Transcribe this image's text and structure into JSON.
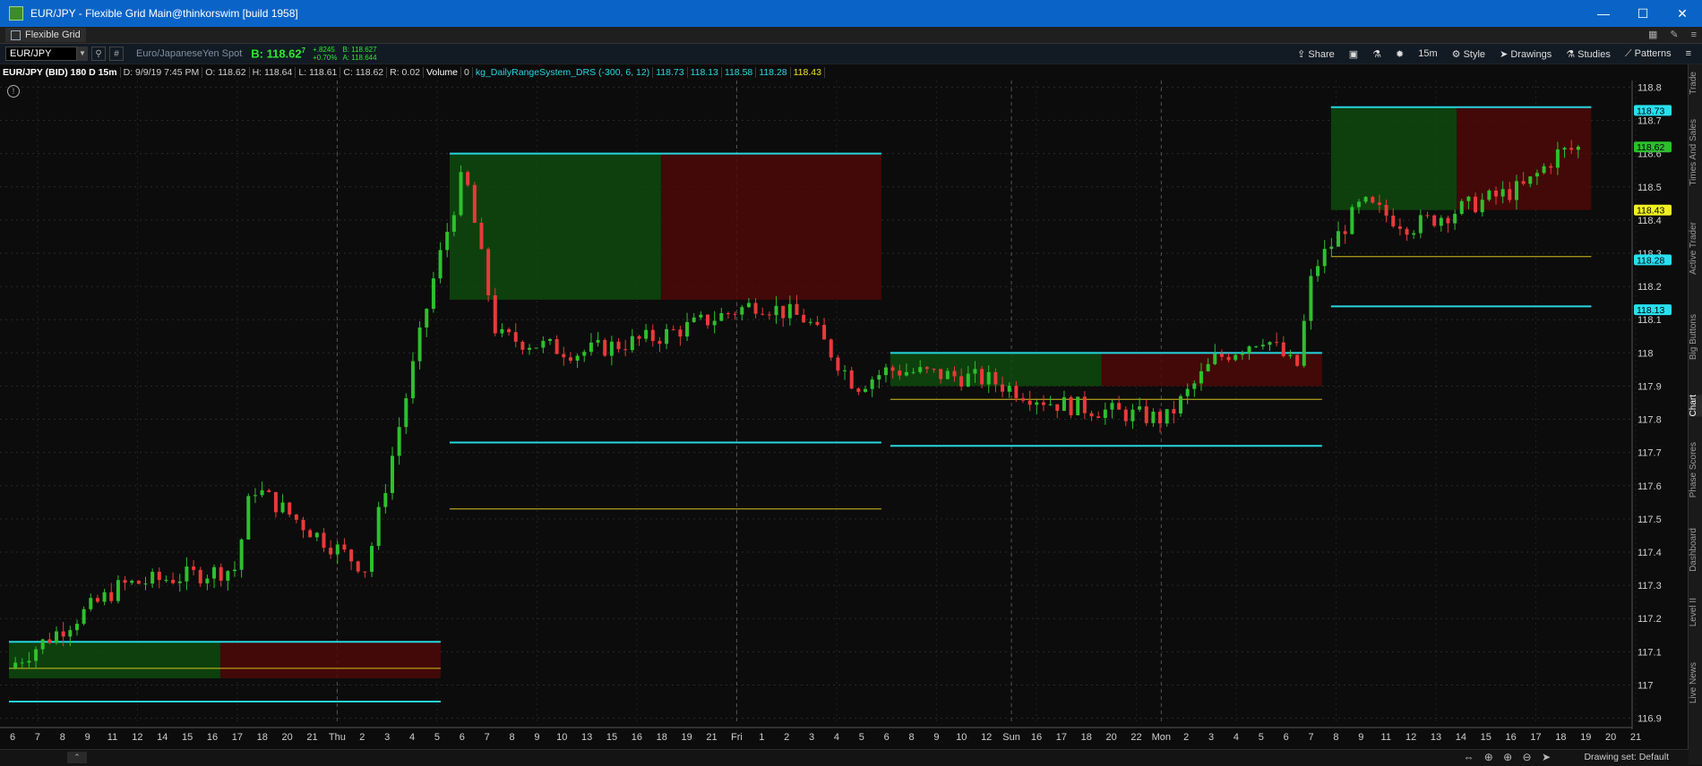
{
  "window": {
    "title": "EUR/JPY - Flexible Grid Main@thinkorswim [build 1958]",
    "min": "—",
    "max": "☐",
    "close": "✕"
  },
  "tabbar": {
    "tab": "Flexible Grid"
  },
  "toolbar": {
    "symbol": "EUR/JPY",
    "description": "Euro/JapaneseYen Spot",
    "bid": "B: 118.62",
    "bid_frac": "7",
    "change_net": "+.8245",
    "change_pct": "+0.70%",
    "bid_small": "B: 118.627",
    "ask_small": "A: 118.644",
    "share": "Share",
    "interval": "15m",
    "style": "Style",
    "drawings": "Drawings",
    "studies": "Studies",
    "patterns": "Patterns"
  },
  "infobar": {
    "title": "EUR/JPY (BID) 180 D 15m",
    "date": "D: 9/9/19 7:45 PM",
    "open": "O: 118.62",
    "high": "H: 118.64",
    "low": "L: 118.61",
    "close": "C: 118.62",
    "range": "R: 0.02",
    "volume_label": "Volume",
    "volume_value": "0",
    "study": "kg_DailyRangeSystem_DRS (-300, 6, 12)",
    "v1": "118.73",
    "v2": "118.13",
    "v3": "118.58",
    "v4": "118.28",
    "v5": "118.43"
  },
  "chart_data": {
    "type": "candlestick",
    "y_axis": {
      "min": 116.88,
      "max": 118.82,
      "ticks": [
        "118.8",
        "118.7",
        "118.6",
        "118.5",
        "118.4",
        "118.3",
        "118.2",
        "118.1",
        "118",
        "117.9",
        "117.8",
        "117.7",
        "117.6",
        "117.5",
        "117.4",
        "117.3",
        "117.2",
        "117.1",
        "117",
        "116.9"
      ]
    },
    "x_ticks": [
      "6",
      "7",
      "8",
      "9",
      "11",
      "12",
      "14",
      "15",
      "16",
      "17",
      "18",
      "20",
      "21",
      "Thu",
      "2",
      "3",
      "4",
      "5",
      "6",
      "7",
      "8",
      "9",
      "10",
      "13",
      "15",
      "16",
      "18",
      "19",
      "21",
      "Fri",
      "1",
      "2",
      "3",
      "4",
      "5",
      "6",
      "8",
      "9",
      "10",
      "12",
      "Sun",
      "16",
      "17",
      "18",
      "20",
      "22",
      "Mon",
      "2",
      "3",
      "4",
      "5",
      "6",
      "7",
      "8",
      "9",
      "11",
      "12",
      "13",
      "14",
      "15",
      "16",
      "17",
      "18",
      "19",
      "20",
      "21"
    ],
    "price_labels": [
      {
        "value": 118.73,
        "text": "118.73",
        "color": "#26e0f0"
      },
      {
        "value": 118.62,
        "text": "118.62",
        "color": "#2cc02c"
      },
      {
        "value": 118.43,
        "text": "118.43",
        "color": "#f0f020"
      },
      {
        "value": 118.28,
        "text": "118.28",
        "color": "#26e0f0"
      },
      {
        "value": 118.13,
        "text": "118.13",
        "color": "#26e0f0"
      }
    ],
    "day_zones": [
      {
        "upper": 117.13,
        "lower": 116.95,
        "mid": 117.02,
        "close_line": 117.05
      },
      {
        "upper": 118.6,
        "lower": 117.73,
        "mid": 118.16,
        "close_line": 117.53
      },
      {
        "upper": 118.0,
        "lower": 117.72,
        "mid": 117.9,
        "close_line": 117.86
      },
      {
        "upper": 118.74,
        "lower": 118.14,
        "mid": 118.43,
        "close_line": 118.29
      }
    ],
    "colors": {
      "up": "#2ec02e",
      "down": "#e83a3a",
      "band_line": "#26d6e0",
      "mid_line": "#d8c020",
      "green_fill": "#0e4a0e",
      "red_fill": "#4e0808"
    },
    "last_price": 118.627
  },
  "sidetabs": [
    "Trade",
    "Times And Sales",
    "Active Trader",
    "Big Buttons",
    "Chart",
    "Phase Scores",
    "Dashboard",
    "Level II",
    "Live News"
  ],
  "statusbar": {
    "drawing_set": "Drawing set: Default"
  }
}
